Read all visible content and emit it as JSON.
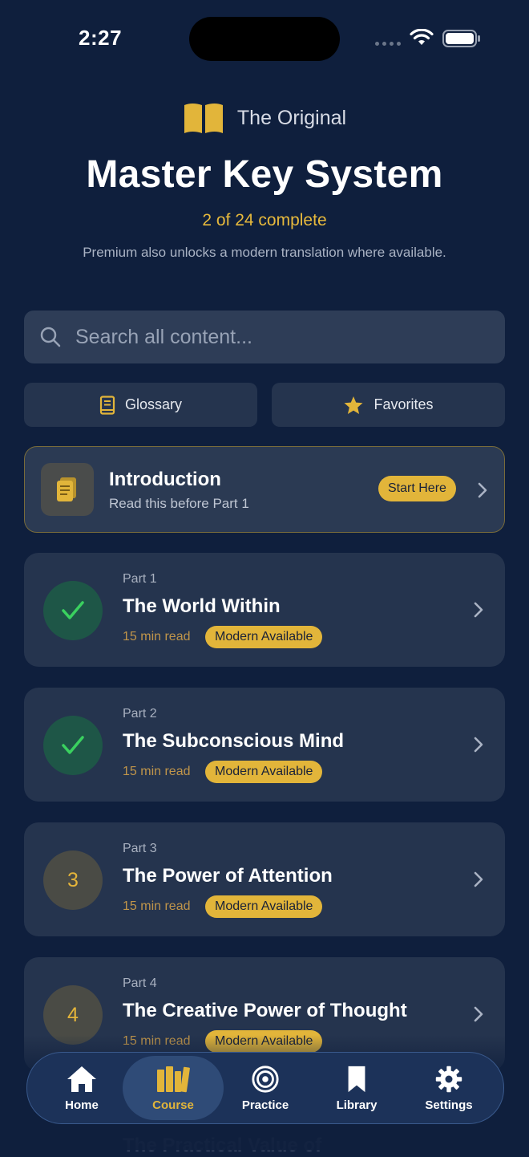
{
  "status": {
    "time": "2:27"
  },
  "header": {
    "subtitle": "The Original",
    "title": "Master Key System",
    "progress": "2 of 24 complete",
    "premium_note": "Premium also unlocks a modern translation where available."
  },
  "search": {
    "placeholder": "Search all content..."
  },
  "quick_actions": {
    "glossary": "Glossary",
    "favorites": "Favorites"
  },
  "intro": {
    "title": "Introduction",
    "subtitle": "Read this before Part 1",
    "badge": "Start Here"
  },
  "parts": [
    {
      "label": "Part 1",
      "title": "The World Within",
      "read_time": "15 min read",
      "badge": "Modern Available",
      "status": "complete"
    },
    {
      "label": "Part 2",
      "title": "The Subconscious Mind",
      "read_time": "15 min read",
      "badge": "Modern Available",
      "status": "complete"
    },
    {
      "label": "Part 3",
      "number": "3",
      "title": "The Power of Attention",
      "read_time": "15 min read",
      "badge": "Modern Available",
      "status": "incomplete"
    },
    {
      "label": "Part 4",
      "number": "4",
      "title": "The Creative Power of Thought",
      "read_time": "15 min read",
      "badge": "Modern Available",
      "status": "incomplete"
    }
  ],
  "next_part_preview": {
    "title": "The Practical Value of"
  },
  "tabbar": {
    "home": "Home",
    "course": "Course",
    "practice": "Practice",
    "library": "Library",
    "settings": "Settings",
    "active": "course"
  },
  "colors": {
    "background": "#0f1f3d",
    "accent": "#e2b53a",
    "card": "#25344e",
    "success": "#34c759"
  }
}
